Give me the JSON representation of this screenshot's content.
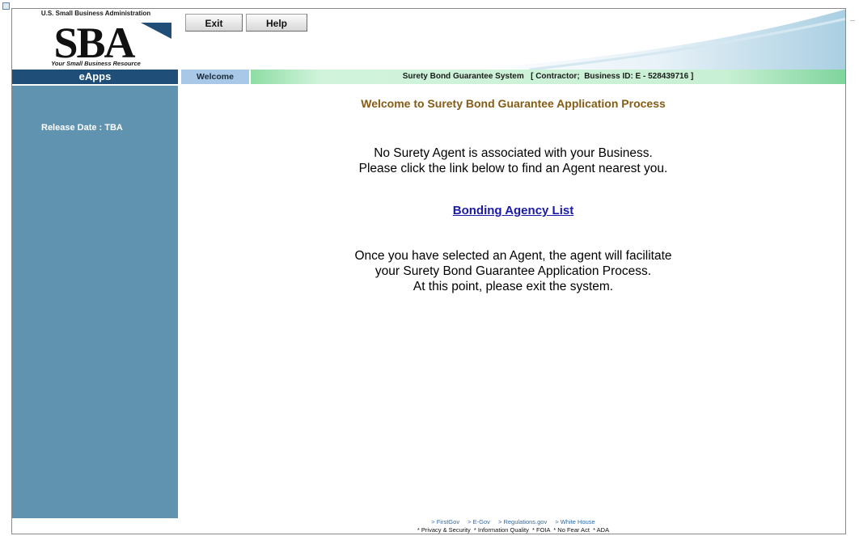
{
  "logo": {
    "agency": "U.S. Small Business Administration",
    "wordmark": "SBA",
    "tagline": "Your Small Business Resource"
  },
  "toolbar": {
    "exit_label": "Exit",
    "help_label": "Help"
  },
  "nav": {
    "app_name": "eApps",
    "tab": "Welcome",
    "system_info": "Surety Bond Guarantee System   [ Contractor;  Business ID: E - 528439716 ]"
  },
  "sidebar": {
    "release": "Release Date : TBA"
  },
  "main": {
    "heading": "Welcome to Surety Bond Guarantee Application Process",
    "message1_line1": "No Surety Agent is associated with your Business.",
    "message1_line2": "Please click the link below to find an Agent nearest you.",
    "link_label": "Bonding Agency List",
    "message2_line1": "Once you have selected an Agent, the agent will facilitate",
    "message2_line2": "your Surety Bond Guarantee Application Process.",
    "message2_line3": "At this point, please exit the system."
  },
  "footer": {
    "links": [
      "> FirstGov",
      "> E-Gov",
      "> Regulations.gov",
      "> White House"
    ],
    "policies": "* Privacy & Security  * Information Quality  * FOIA  * No Fear Act  * ADA"
  },
  "colors": {
    "sidebar": "#5f93b0",
    "eapps_bar": "#1f4f79",
    "heading": "#845c16",
    "link": "#1a1aa8"
  }
}
